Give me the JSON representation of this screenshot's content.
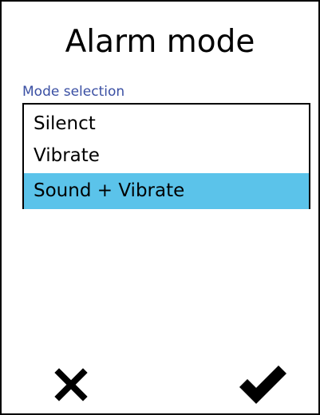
{
  "title": "Alarm mode",
  "mode_selection": {
    "label": "Mode selection",
    "options": [
      "Silenct",
      "Vibrate",
      "Sound + Vibrate"
    ],
    "selected": "Sound + Vibrate"
  },
  "buttons": {
    "cancel_icon": "close-icon",
    "confirm_icon": "check-icon"
  },
  "colors": {
    "selection": "#5bc3ea",
    "label": "#3a4fa3"
  }
}
